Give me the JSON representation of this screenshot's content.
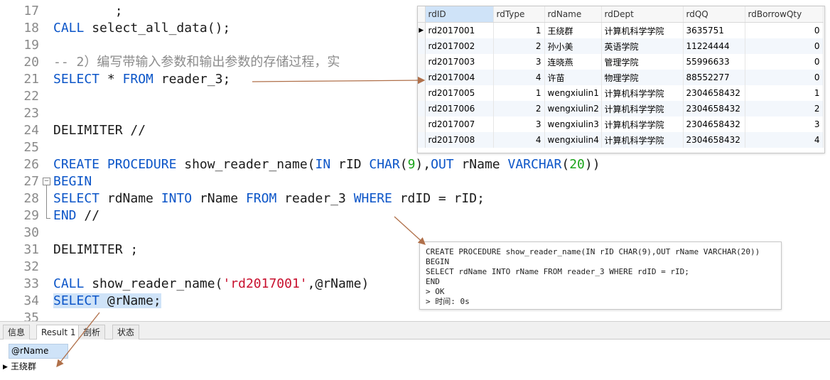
{
  "editor": {
    "lines": [
      {
        "n": "17",
        "html": "        ;"
      },
      {
        "n": "18",
        "html": "<span class=\"kw\">CALL</span> select_all_data();"
      },
      {
        "n": "19",
        "html": ""
      },
      {
        "n": "20",
        "html": "<span class=\"cm\">-- 2）编写带输入参数和输出参数的存储过程，实</span>"
      },
      {
        "n": "21",
        "html": "<span class=\"kw\">SELECT</span> * <span class=\"kw\">FROM</span> reader_3;"
      },
      {
        "n": "22",
        "html": ""
      },
      {
        "n": "23",
        "html": ""
      },
      {
        "n": "24",
        "html": "DELIMITER //"
      },
      {
        "n": "25",
        "html": ""
      },
      {
        "n": "26",
        "html": "<span class=\"kw\">CREATE</span> <span class=\"kw\">PROCEDURE</span> show_reader_name(<span class=\"kw\">IN</span> rID <span class=\"kw\">CHAR</span>(<span class=\"num\">9</span>),<span class=\"kw\">OUT</span> rName <span class=\"kw\">VARCHAR</span>(<span class=\"num\">20</span>))"
      },
      {
        "n": "27",
        "html": "<span class=\"kw\">BEGIN</span>"
      },
      {
        "n": "28",
        "html": "<span class=\"kw\">SELECT</span> rdName <span class=\"kw\">INTO</span> rName <span class=\"kw\">FROM</span> reader_3 <span class=\"kw\">WHERE</span> rdID = rID;"
      },
      {
        "n": "29",
        "html": "<span class=\"kw\">END</span> //"
      },
      {
        "n": "30",
        "html": ""
      },
      {
        "n": "31",
        "html": "DELIMITER ;"
      },
      {
        "n": "32",
        "html": ""
      },
      {
        "n": "33",
        "html": "<span class=\"kw\">CALL</span> show_reader_name(<span class=\"str\">'rd2017001'</span>,@rName)"
      },
      {
        "n": "34",
        "html": "<span class=\"hl\"><span class=\"kw\">SELECT</span> @rName;</span>"
      },
      {
        "n": "35",
        "html": ""
      }
    ]
  },
  "grid": {
    "columns": [
      "rdID",
      "rdType",
      "rdName",
      "rdDept",
      "rdQQ",
      "rdBorrowQty"
    ],
    "rows": [
      [
        "rd2017001",
        "1",
        "王绕群",
        "计算机科学学院",
        "3635751",
        "0"
      ],
      [
        "rd2017002",
        "2",
        "孙小美",
        "英语学院",
        "11224444",
        "0"
      ],
      [
        "rd2017003",
        "3",
        "连晓燕",
        "管理学院",
        "55996633",
        "0"
      ],
      [
        "rd2017004",
        "4",
        "许苗",
        "物理学院",
        "88552277",
        "0"
      ],
      [
        "rd2017005",
        "1",
        "wengxiulin1",
        "计算机科学学院",
        "2304658432",
        "1"
      ],
      [
        "rd2017006",
        "2",
        "wengxiulin2",
        "计算机科学学院",
        "2304658432",
        "2"
      ],
      [
        "rd2017007",
        "3",
        "wengxiulin3",
        "计算机科学学院",
        "2304658432",
        "3"
      ],
      [
        "rd2017008",
        "4",
        "wengxiulin4",
        "计算机科学学院",
        "2304658432",
        "4"
      ]
    ]
  },
  "message": {
    "text": "CREATE PROCEDURE show_reader_name(IN rID CHAR(9),OUT rName VARCHAR(20))\nBEGIN\nSELECT rdName INTO rName FROM reader_3 WHERE rdID = rID;\nEND\n> OK\n> 时间: 0s"
  },
  "tabs": {
    "info": "信息",
    "result1": "Result 1",
    "profile": "剖析",
    "status": "状态"
  },
  "result": {
    "column": "@rName",
    "value": "王绕群"
  },
  "colors": {
    "keyword": "#0b55c8",
    "string": "#c8102e",
    "number": "#19a319",
    "arrow": "#b0704a",
    "selection": "#cfe3f8"
  }
}
